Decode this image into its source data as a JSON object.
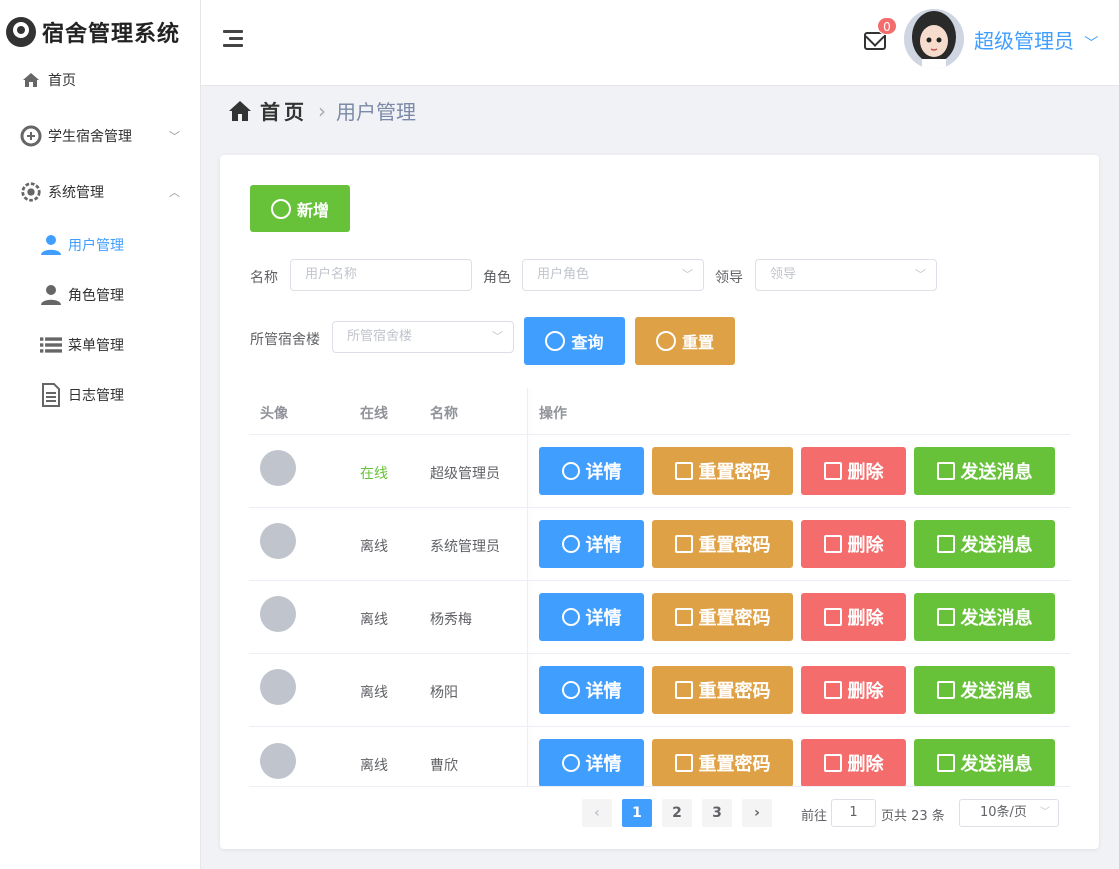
{
  "app": {
    "title": "宿舍管理系统"
  },
  "sidebar": {
    "items": [
      {
        "label": "首页",
        "icon": "home-icon"
      },
      {
        "label": "学生宿舍管理",
        "icon": "dorm-icon",
        "arrow": "﹀"
      },
      {
        "label": "系统管理",
        "icon": "settings-icon",
        "arrow": "︿"
      },
      {
        "label": "用户管理",
        "icon": "user-icon",
        "active": true
      },
      {
        "label": "角色管理",
        "icon": "role-icon"
      },
      {
        "label": "菜单管理",
        "icon": "menu-list-icon"
      },
      {
        "label": "日志管理",
        "icon": "log-icon"
      }
    ]
  },
  "header": {
    "badge_count": "0",
    "username": "超级管理员",
    "dropdown_icon": "﹀"
  },
  "breadcrumb": {
    "home": "首页",
    "separator": "›",
    "current": "用户管理"
  },
  "toolbar": {
    "add_label": "新增"
  },
  "filters": {
    "name_label": "名称",
    "name_placeholder": "用户名称",
    "role_label": "角色",
    "role_placeholder": "用户角色",
    "leader_label": "领导",
    "leader_placeholder": "领导",
    "building_label": "所管宿舍楼",
    "building_placeholder": "所管宿舍楼",
    "search_label": "查询",
    "reset_label": "重置"
  },
  "table": {
    "headers": {
      "avatar": "头像",
      "online": "在线",
      "name": "名称",
      "ops": "操作"
    },
    "rows": [
      {
        "status": "在线",
        "name": "超级管理员"
      },
      {
        "status": "离线",
        "name": "系统管理员"
      },
      {
        "status": "离线",
        "name": "杨秀梅"
      },
      {
        "status": "离线",
        "name": "杨阳"
      },
      {
        "status": "离线",
        "name": "曹欣"
      }
    ],
    "actions": {
      "detail": "详情",
      "reset_pwd": "重置密码",
      "delete": "删除",
      "message": "发送消息"
    }
  },
  "pagination": {
    "prev": "‹",
    "next": "›",
    "pages": [
      "1",
      "2",
      "3"
    ],
    "current": 1,
    "goto_label": "前往",
    "goto_value": "1",
    "total_label": "页共 23 条",
    "page_size": "10条/页"
  }
}
